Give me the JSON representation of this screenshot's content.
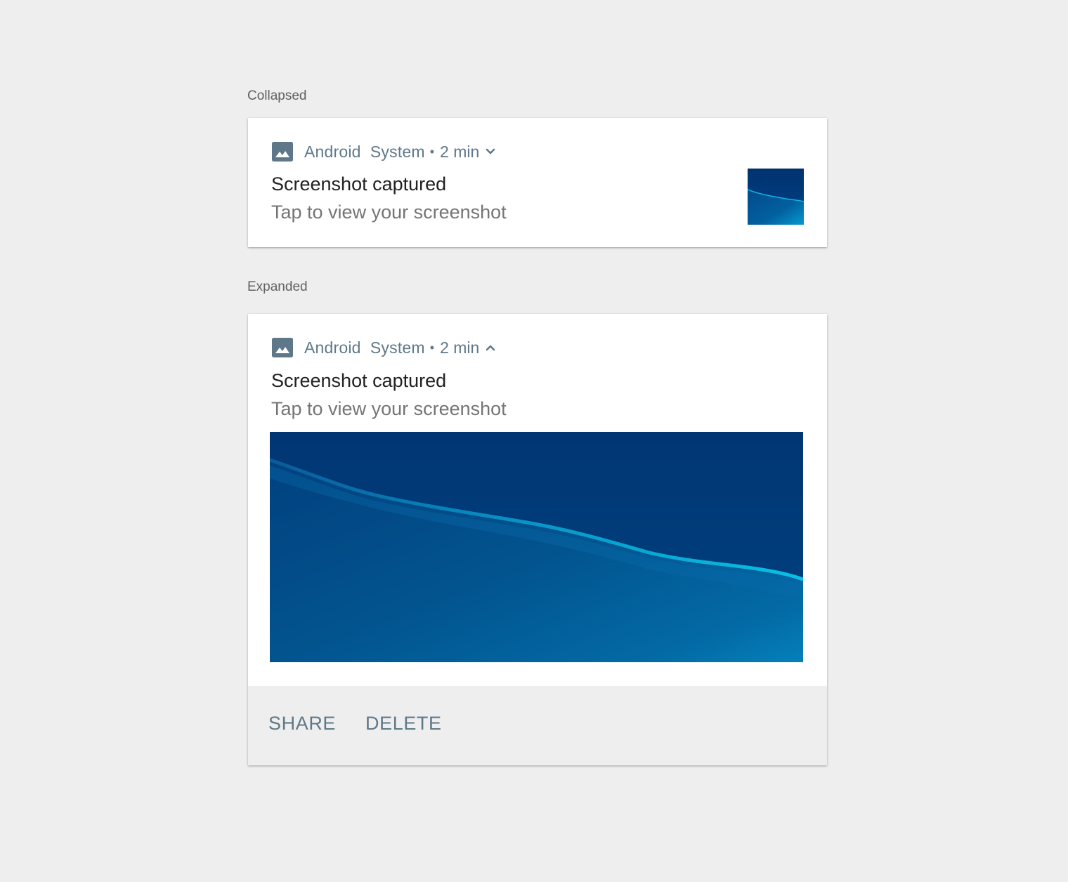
{
  "sections": {
    "collapsed_label": "Collapsed",
    "expanded_label": "Expanded"
  },
  "collapsed": {
    "app_name_part1": "Android",
    "app_name_part2": "System",
    "separator": "•",
    "time": "2 min",
    "chevron": "chevron-down-icon",
    "title": "Screenshot captured",
    "subtitle": "Tap to view your screenshot"
  },
  "expanded": {
    "app_name_part1": "Android",
    "app_name_part2": "System",
    "separator": "•",
    "time": "2 min",
    "chevron": "chevron-up-icon",
    "title": "Screenshot captured",
    "subtitle": "Tap to view your screenshot",
    "actions": {
      "share": "SHARE",
      "delete": "DELETE"
    }
  },
  "colors": {
    "background": "#eeeeee",
    "accent_text": "#5f7889",
    "title_text": "#212121",
    "subtitle_text": "#757575",
    "image_dark_blue": "#013674",
    "image_light_blue": "#05b3db"
  }
}
